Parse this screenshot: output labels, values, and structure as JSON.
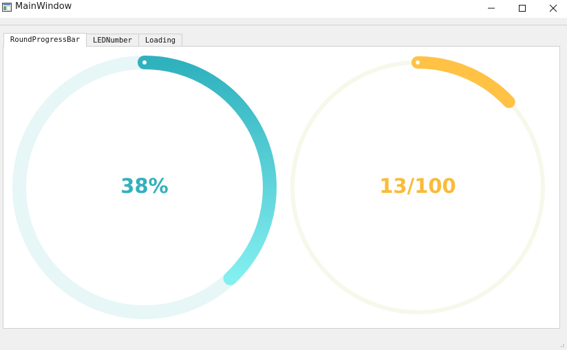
{
  "window": {
    "title": "MainWindow"
  },
  "tabs": [
    {
      "label": "RoundProgressBar",
      "active": true
    },
    {
      "label": "LEDNumber",
      "active": false
    },
    {
      "label": "Loading",
      "active": false
    }
  ],
  "progress_left": {
    "text": "38%",
    "value_fraction": 0.38,
    "track_color": "#e7f6f7",
    "gradient_start": "#2fb1be",
    "gradient_end": "#83eff0",
    "text_color": "#33b0bd"
  },
  "progress_right": {
    "text": "13/100",
    "value": 13,
    "max": 100,
    "track_color": "#f6f8ea",
    "bar_color": "#ffc245",
    "text_color": "#f9bb3a"
  },
  "icons": {
    "app": "app-window-icon",
    "minimize": "minimize-icon",
    "maximize": "maximize-icon",
    "close": "close-icon"
  }
}
